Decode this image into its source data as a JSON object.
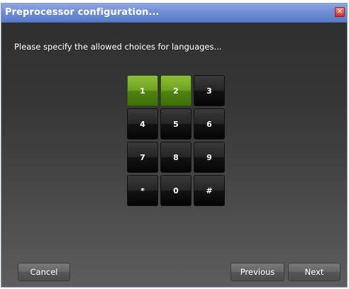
{
  "window": {
    "title": "Preprocessor configuration...",
    "close_glyph": "✕"
  },
  "prompt": "Please specify the allowed choices for languages...",
  "keypad": {
    "keys": [
      "1",
      "2",
      "3",
      "4",
      "5",
      "6",
      "7",
      "8",
      "9",
      "*",
      "0",
      "#"
    ],
    "selected": [
      "1",
      "2"
    ],
    "selected_color": "#6ea21f"
  },
  "buttons": {
    "cancel": "Cancel",
    "previous": "Previous",
    "next": "Next"
  },
  "colors": {
    "titlebar": "#6f8dd3",
    "background": "#363636",
    "close": "#c83232"
  }
}
